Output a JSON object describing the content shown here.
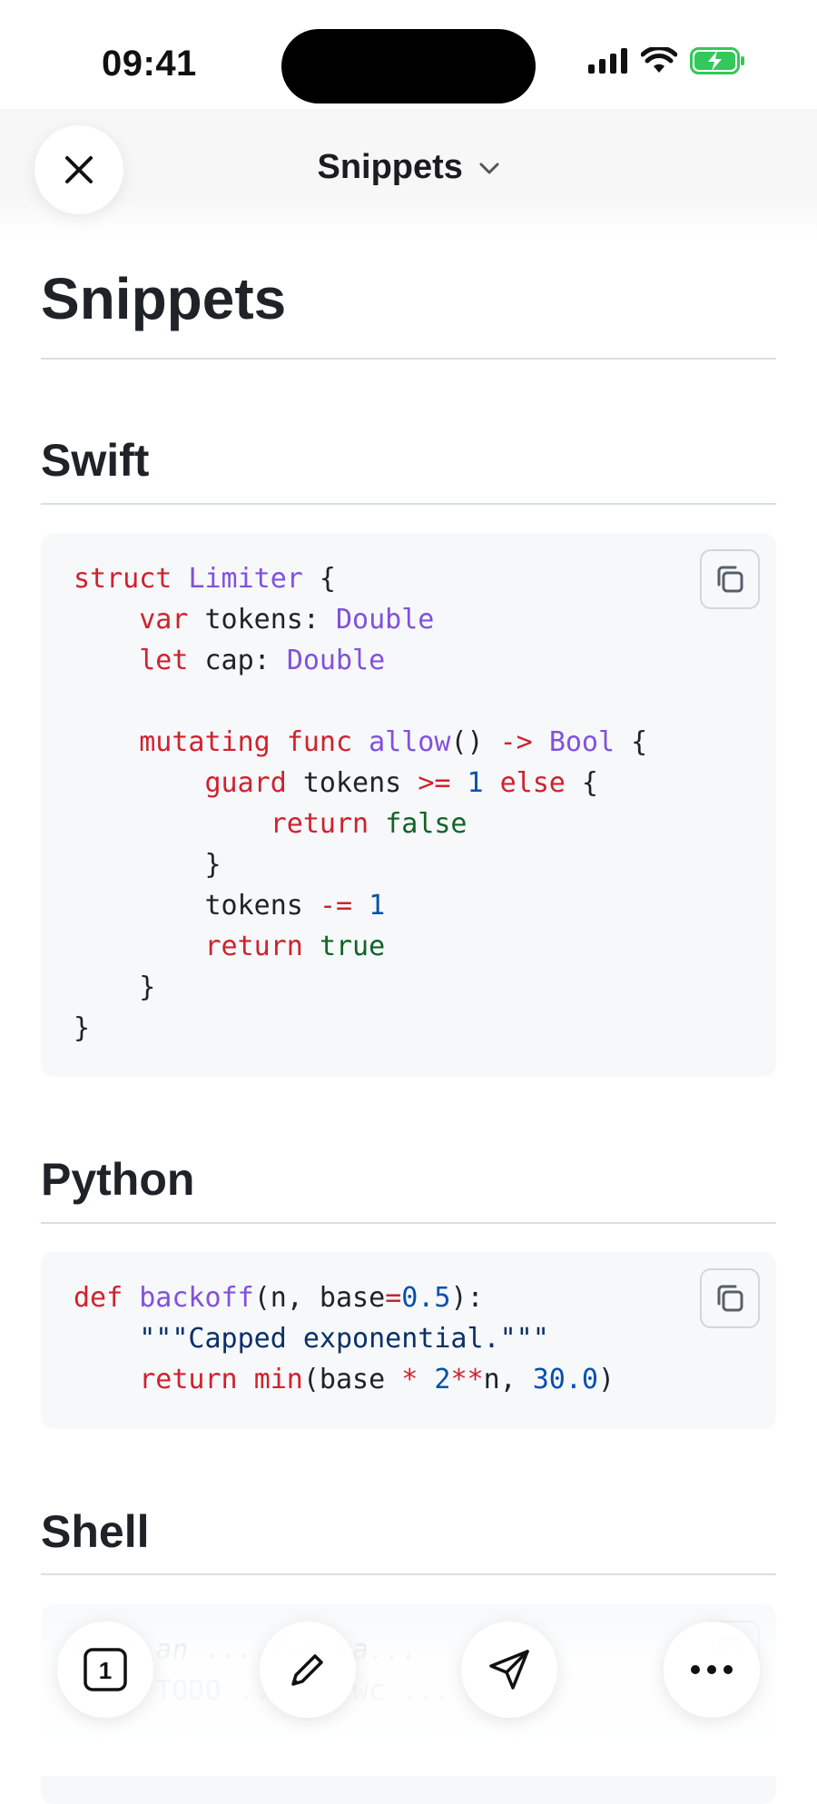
{
  "status_bar": {
    "time": "09:41"
  },
  "nav": {
    "title": "Snippets"
  },
  "page": {
    "title": "Snippets"
  },
  "sections": [
    {
      "heading": "Swift",
      "language": "swift",
      "code_lines": [
        "struct Limiter {",
        "    var tokens: Double",
        "    let cap: Double",
        "",
        "    mutating func allow() -> Bool {",
        "        guard tokens >= 1 else {",
        "            return false",
        "        }",
        "        tokens -= 1",
        "        return true",
        "    }",
        "}"
      ]
    },
    {
      "heading": "Python",
      "language": "python",
      "code_lines": [
        "def backoff(n, base=0.5):",
        "    \"\"\"Capped exponential.\"\"\"",
        "    return min(base * 2**n, 30.0)"
      ]
    },
    {
      "heading": "Shell",
      "language": "shell",
      "code_lines": [
        "# is an ... for ba...",
        "... \"TODO ...\" | wc ..."
      ]
    }
  ],
  "toolbar": {
    "tabs_count": "1",
    "tabs_icon": "tabs-icon",
    "edit_icon": "pencil-icon",
    "share_icon": "send-icon",
    "more_icon": "ellipsis-icon"
  },
  "colors": {
    "keyword": "#cf222e",
    "type": "#8250df",
    "number": "#0550ae",
    "boolean": "#116329",
    "code_background": "#f6f8fa",
    "battery": "#34c759"
  }
}
